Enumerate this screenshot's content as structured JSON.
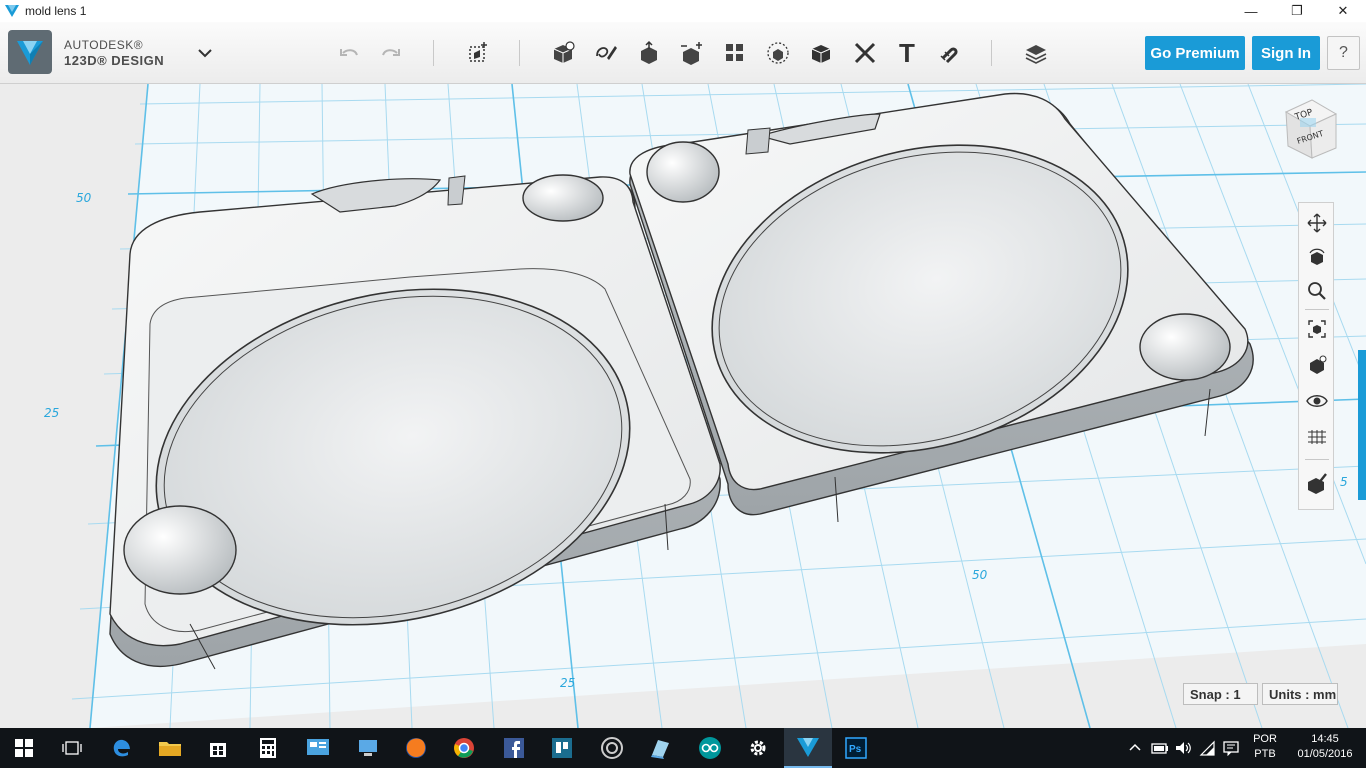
{
  "window": {
    "title": "mold lens 1",
    "minimize": "—",
    "maximize": "❐",
    "close": "✕"
  },
  "brand": {
    "line1": "AUTODESK®",
    "line2": "123D® DESIGN"
  },
  "toolbar": {
    "go_premium": "Go Premium",
    "sign_in": "Sign In",
    "help": "?",
    "text_tool": "T"
  },
  "navcube": {
    "top": "TOP",
    "front": "FRONT"
  },
  "grid_labels": {
    "left_50": "50",
    "left_25": "25",
    "bottom_25": "25",
    "bottom_50": "50",
    "right_partial": "5"
  },
  "status": {
    "snap": "Snap : 1",
    "units": "Units : mm"
  },
  "taskbar": {
    "lang_line1": "POR",
    "lang_line2": "PTB",
    "time": "14:45",
    "date": "01/05/2016"
  },
  "colors": {
    "accent": "#1a9bd7",
    "grid_line": "#8fd0ec",
    "viewport_bg": "#ececec",
    "taskbar": "#101418"
  }
}
